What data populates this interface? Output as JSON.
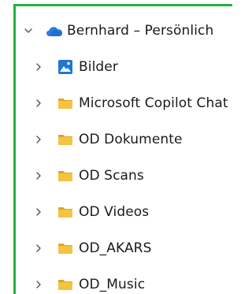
{
  "colors": {
    "highlight_border": "#1fb142",
    "onedrive_blue": "#2a7de1",
    "folder_yellow": "#f5c342",
    "folder_yellow_dark": "#e0a526",
    "pictures_blue": "#1e78d2",
    "chevron": "#555555",
    "text": "#1a1a1a"
  },
  "tree": {
    "root": {
      "label": "Bernhard – Persönlich",
      "icon": "onedrive-cloud-icon",
      "expanded": true
    },
    "children": [
      {
        "label": "Bilder",
        "icon": "pictures-folder-icon",
        "expanded": false
      },
      {
        "label": "Microsoft Copilot Chat",
        "icon": "folder-icon",
        "expanded": false
      },
      {
        "label": "OD Dokumente",
        "icon": "folder-icon",
        "expanded": false
      },
      {
        "label": "OD Scans",
        "icon": "folder-icon",
        "expanded": false
      },
      {
        "label": "OD Videos",
        "icon": "folder-icon",
        "expanded": false
      },
      {
        "label": "OD_AKARS",
        "icon": "folder-icon",
        "expanded": false
      },
      {
        "label": "OD_Music",
        "icon": "folder-icon",
        "expanded": false
      }
    ]
  }
}
